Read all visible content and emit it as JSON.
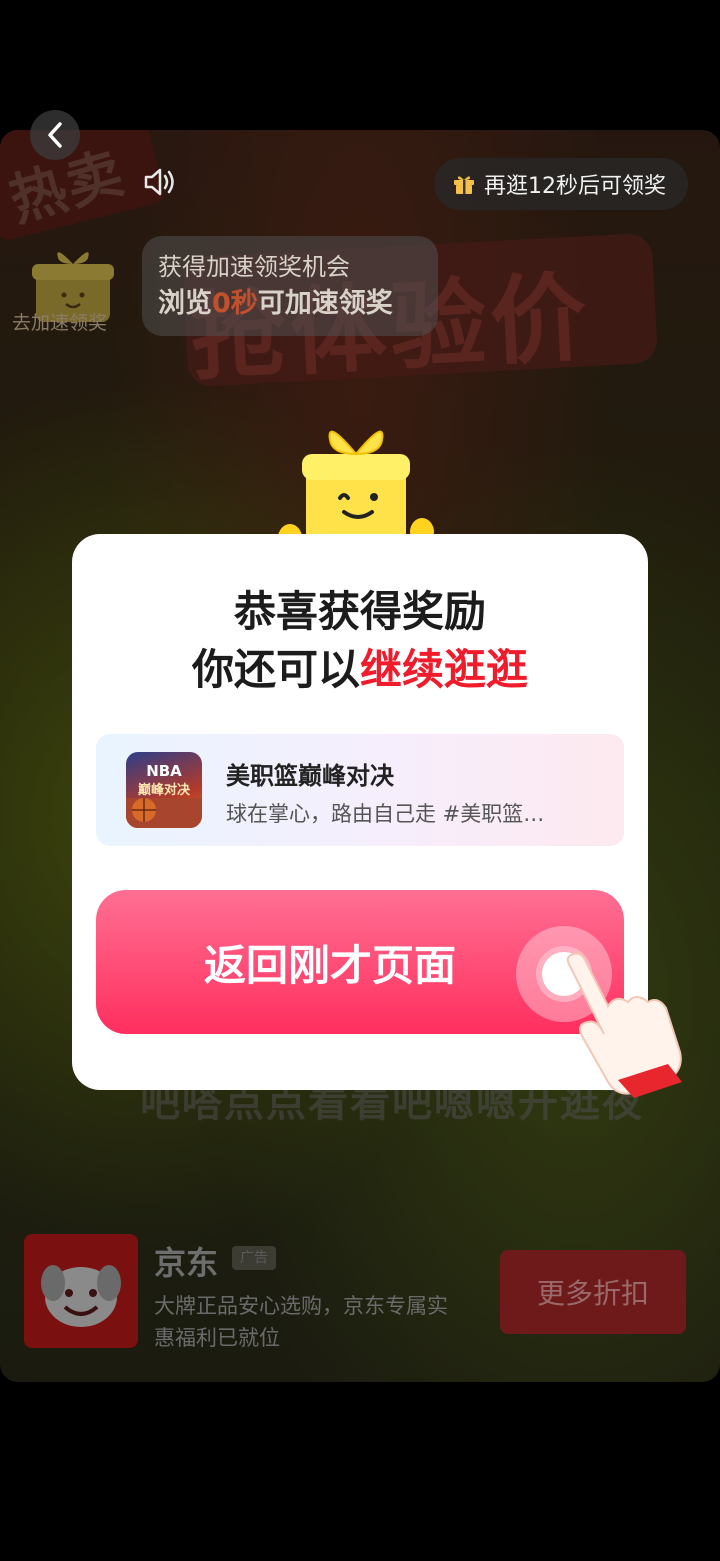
{
  "header": {
    "timer_text": "再逛12秒后可领奖"
  },
  "speed_up": {
    "gift_label": "去加速领奖",
    "tip_line1": "获得加速领奖机会",
    "tip_line2_prefix": "浏览",
    "tip_line2_highlight": "0秒",
    "tip_line2_suffix": "可加速领奖"
  },
  "background": {
    "hot_text": "热卖",
    "banner_text": "抢体验价",
    "mid_text": "吧嗒点点看看吧嗯嗯开逛夜"
  },
  "modal": {
    "title": "恭喜获得奖励",
    "subtitle_prefix": "你还可以",
    "subtitle_accent": "继续逛逛",
    "app_card": {
      "icon_text": "NBA\n巅峰对决",
      "name": "美职篮巅峰对决",
      "description": "球在掌心，路由自己走 #美职篮…"
    },
    "return_button": "返回刚才页面"
  },
  "ad": {
    "title": "京东",
    "badge": "广告",
    "description": "大牌正品安心选购，京东专属实惠福利已就位",
    "cta": "更多折扣"
  },
  "colors": {
    "accent_red": "#f01c2c",
    "button_pink": "#ff2f5e",
    "timer_gift": "#f5c14a"
  }
}
